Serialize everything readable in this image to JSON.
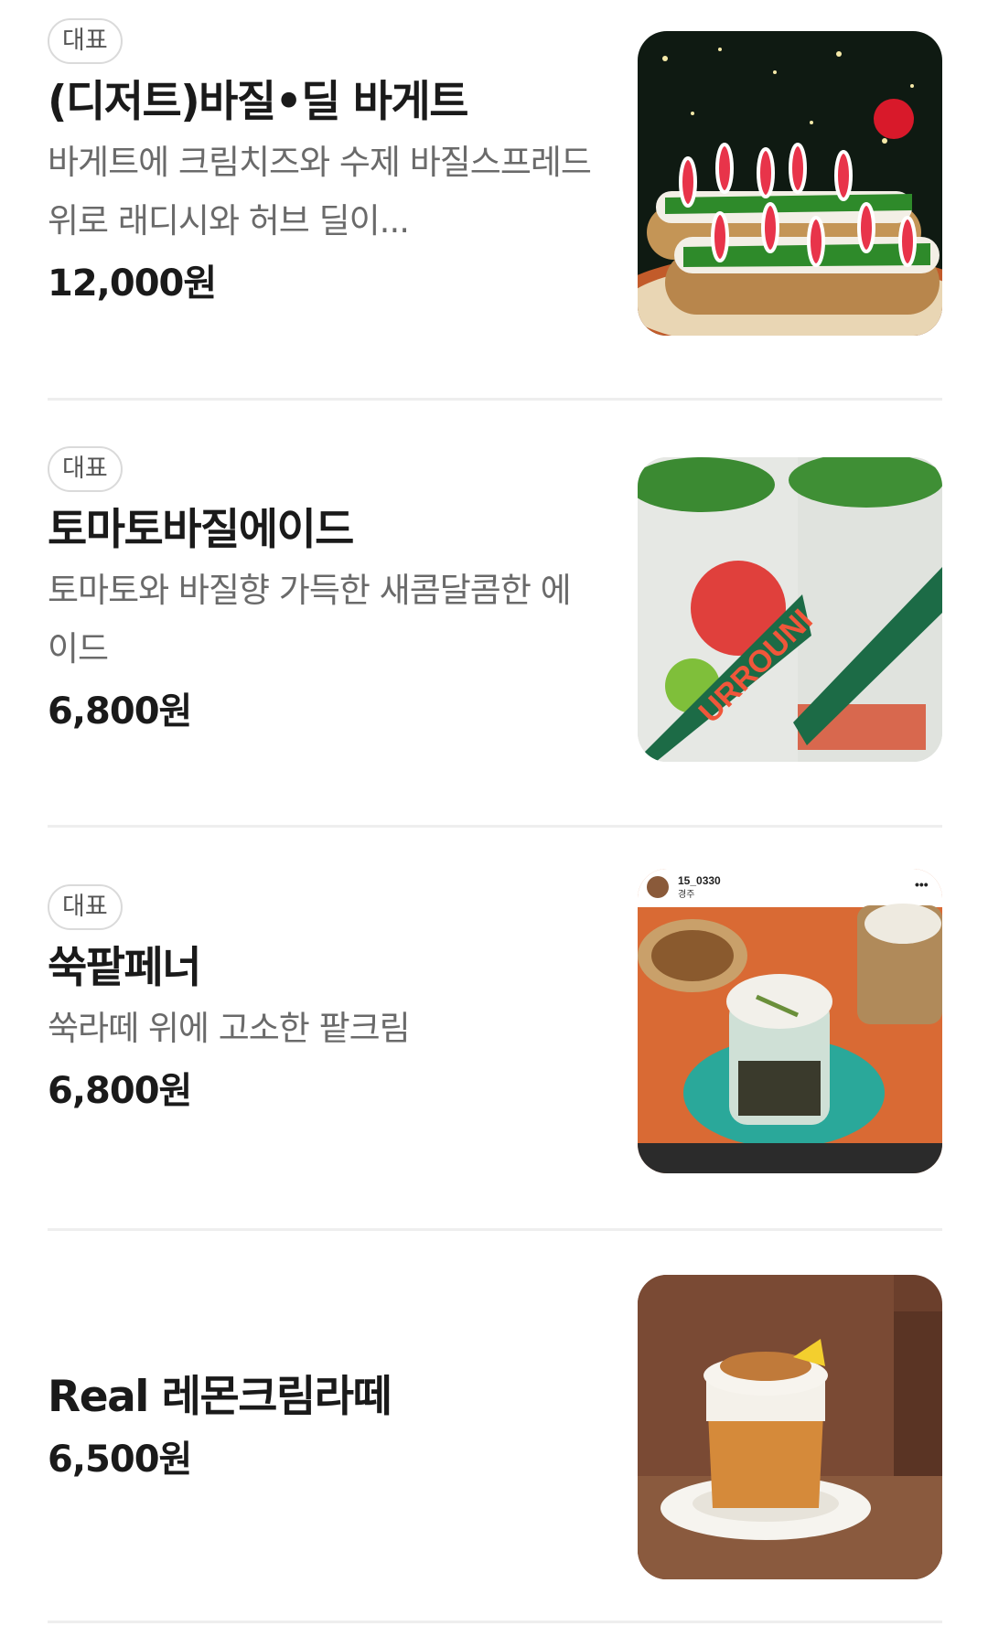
{
  "menu": {
    "items": [
      {
        "badge": "대표",
        "name": "(디저트)바질•딜 바게트",
        "description": "바게트에 크림치즈와 수제 바질스프레드위로 래디시와 허브 딜이...",
        "price": "12,000원",
        "image": "basil-dill-baguette-photo"
      },
      {
        "badge": "대표",
        "name": "토마토바질에이드",
        "description": "토마토와 바질향 가득한 새콤달콤한 에이드",
        "price": "6,800원",
        "image": "tomato-basil-ade-photo",
        "image_caption": "URROUNI"
      },
      {
        "badge": "대표",
        "name": "쑥팥페너",
        "description": "쑥라떼 위에 고소한 팥크림",
        "price": "6,800원",
        "image": "mugwort-redbean-drink-photo",
        "image_username": "15_0330",
        "image_location": "경주"
      },
      {
        "name": "Real 레몬크림라떼",
        "price": "6,500원",
        "image": "lemon-cream-latte-photo"
      }
    ]
  }
}
